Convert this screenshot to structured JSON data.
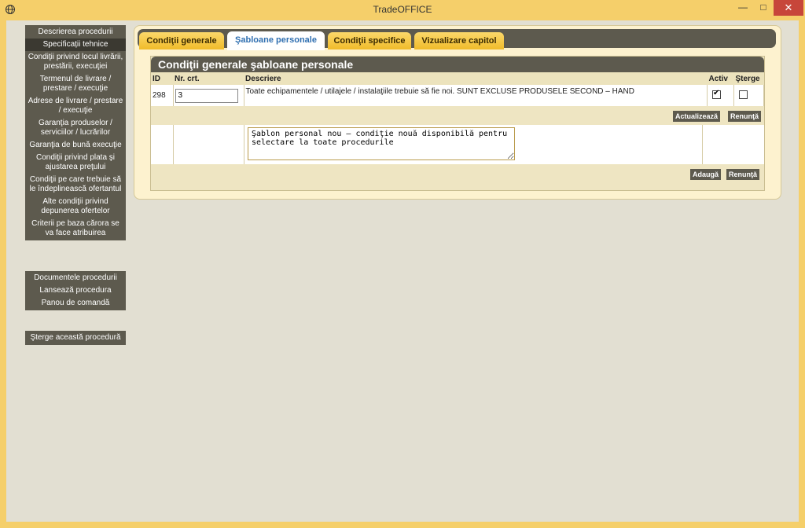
{
  "window": {
    "title": "TradeOFFICE",
    "icons": {
      "app": "globe-icon",
      "minimize": "minimize-icon",
      "maximize": "maximize-icon",
      "close": "close-icon"
    },
    "colors": {
      "frame": "#f5cf6a",
      "close": "#c7463a",
      "nav": "#5d5a4e",
      "tab_active_text": "#2f6fb0"
    }
  },
  "sidebar": {
    "group1": [
      "Descrierea procedurii",
      "Specificații tehnice",
      "Condiţii privind locul livrării, prestării, execuţiei",
      "Termenul de livrare / prestare / execuţie",
      "Adrese de livrare / prestare / execuţie",
      "Garanţia produselor / serviciilor / lucrărilor",
      "Garanţia de bună execuţie",
      "Condiţii privind plata şi ajustarea preţului",
      "Condiţii pe care trebuie să le îndeplinească ofertantul",
      "Alte condiţii privind depunerea ofertelor",
      "Criterii pe baza cărora se va face atribuirea"
    ],
    "group2": [
      "Documentele procedurii",
      "Lansează procedura",
      "Panou de comandă"
    ],
    "group3": [
      "Şterge această procedură"
    ]
  },
  "tabs": [
    "Condiţii generale",
    "Şabloane personale",
    "Condiţii specifice",
    "Vizualizare capitol"
  ],
  "panel": {
    "title": "Condiţii generale şabloane personale",
    "columns": {
      "id": "ID",
      "nr": "Nr. crt.",
      "descriere": "Descriere",
      "activ": "Activ",
      "sterge": "Şterge"
    },
    "rows": [
      {
        "id": "298",
        "nr": "3",
        "descriere": "Toate echipamentele / utilajele / instalaţiile trebuie să fie noi. SUNT EXCLUSE PRODUSELE SECOND – HAND",
        "activ": true,
        "sterge": false
      }
    ],
    "update_button": "Actualizează",
    "cancel_button": "Renunţă",
    "new_template_text": "Şablon personal nou – condiţie nouă disponibilă pentru selectare la toate procedurile",
    "add_button": "Adaugă",
    "cancel_button_2": "Renunţă"
  }
}
